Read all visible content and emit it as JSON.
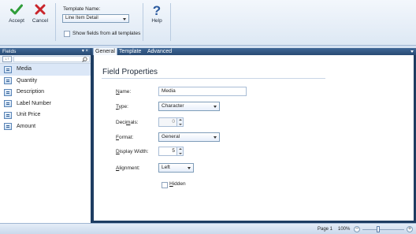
{
  "ribbon": {
    "accept_label": "Accept",
    "cancel_label": "Cancel",
    "template_name_label": "Template Name:",
    "template_name_value": "Line Item Detail",
    "show_all_label": "Show fields from all templates",
    "help_label": "Help",
    "help_glyph": "?"
  },
  "fields_panel": {
    "title": "Fields",
    "header_controls": "▾ ×",
    "sort_glyph": "↓↑",
    "items": [
      {
        "label": "Media"
      },
      {
        "label": "Quantity"
      },
      {
        "label": "Description"
      },
      {
        "label": "Label Number"
      },
      {
        "label": "Unit Price"
      },
      {
        "label": "Amount"
      }
    ]
  },
  "tabs": [
    {
      "label": "General"
    },
    {
      "label": "Template"
    },
    {
      "label": "Advanced"
    }
  ],
  "properties": {
    "title": "Field Properties",
    "name_label_u": "N",
    "name_label_rest": "ame:",
    "name_value": "Media",
    "type_label_u": "T",
    "type_label_rest": "ype:",
    "type_value": "Character",
    "decimals_label_pre": "Deci",
    "decimals_label_u": "m",
    "decimals_label_rest": "als:",
    "decimals_value": "0",
    "format_label_u": "F",
    "format_label_rest": "ormat:",
    "format_value": "General",
    "width_label_u": "D",
    "width_label_rest": "isplay Width:",
    "width_value": "5",
    "align_label_u": "A",
    "align_label_rest": "lignment:",
    "align_value": "Left",
    "hidden_label_u": "H",
    "hidden_label_rest": "idden"
  },
  "status": {
    "page": "Page 1",
    "zoom": "100%",
    "zoom_minus": "−",
    "zoom_plus": "+",
    "zoom_level": 0.37
  },
  "colors": {
    "accept_check": "#2f9d3a",
    "cancel_x": "#c9252b",
    "help_icon": "#2b5a9e",
    "panel_header": "#2f5585"
  },
  "icons": {
    "accept": "checkmark-icon",
    "cancel": "x-icon",
    "help": "question-mark-icon",
    "search": "magnifier-icon",
    "field": "field-list-icon"
  }
}
